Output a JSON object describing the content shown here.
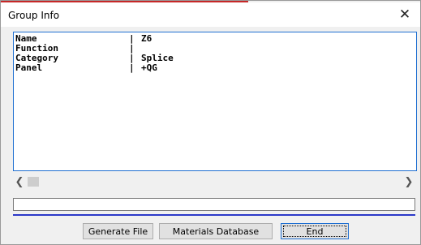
{
  "window": {
    "title": "Group Info",
    "close_icon": "close-icon"
  },
  "details": {
    "rows": [
      {
        "field": "Name",
        "separator": "|",
        "value": "Z6"
      },
      {
        "field": "Function",
        "separator": "|",
        "value": ""
      },
      {
        "field": "Category",
        "separator": "|",
        "value": "Splice"
      },
      {
        "field": "Panel",
        "separator": "|",
        "value": "+QG"
      }
    ]
  },
  "scrollbar": {
    "left_icon": "chevron-left-icon",
    "right_icon": "chevron-right-icon"
  },
  "status_field": {
    "value": ""
  },
  "buttons": {
    "generate_file": "Generate File",
    "materials_database": "Materials Database",
    "end": "End"
  },
  "colors": {
    "list_border": "#1f6fd1",
    "divider_line": "#2b38c8",
    "title_accent": "#c62828"
  }
}
